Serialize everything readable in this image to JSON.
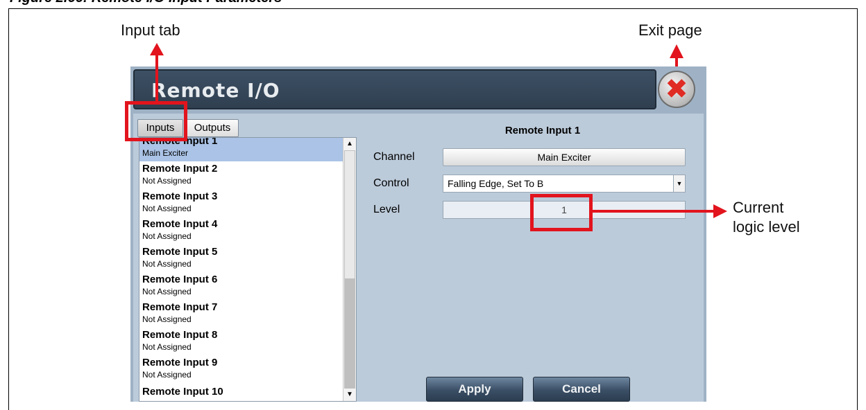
{
  "figure_caption": "Figure 2.66: Remote I/O Input Parameters",
  "callouts": {
    "input_tab": "Input tab",
    "exit_page": "Exit page",
    "current_logic_level": [
      "Current",
      "logic level"
    ]
  },
  "dialog": {
    "title": "Remote I/O",
    "close_icon": "close-x-icon",
    "tabs": [
      {
        "label": "Inputs",
        "selected": true
      },
      {
        "label": "Outputs",
        "selected": false
      }
    ],
    "list": [
      {
        "title": "Remote Input 1",
        "subtitle": "Main Exciter",
        "selected": true
      },
      {
        "title": "Remote Input 2",
        "subtitle": "Not Assigned"
      },
      {
        "title": "Remote Input 3",
        "subtitle": "Not Assigned"
      },
      {
        "title": "Remote Input 4",
        "subtitle": "Not Assigned"
      },
      {
        "title": "Remote Input 5",
        "subtitle": "Not Assigned"
      },
      {
        "title": "Remote Input 6",
        "subtitle": "Not Assigned"
      },
      {
        "title": "Remote Input 7",
        "subtitle": "Not Assigned"
      },
      {
        "title": "Remote Input 8",
        "subtitle": "Not Assigned"
      },
      {
        "title": "Remote Input 9",
        "subtitle": "Not Assigned"
      },
      {
        "title": "Remote Input 10",
        "subtitle": ""
      }
    ],
    "panel": {
      "title": "Remote Input 1",
      "channel_label": "Channel",
      "channel_value": "Main Exciter",
      "control_label": "Control",
      "control_value": "Falling Edge, Set To B",
      "level_label": "Level",
      "level_value": "1"
    },
    "buttons": {
      "apply": "Apply",
      "cancel": "Cancel"
    }
  },
  "colors": {
    "highlight": "#e2141d",
    "selected_row": "#aac3e6",
    "titlebar": "#3d5064"
  }
}
